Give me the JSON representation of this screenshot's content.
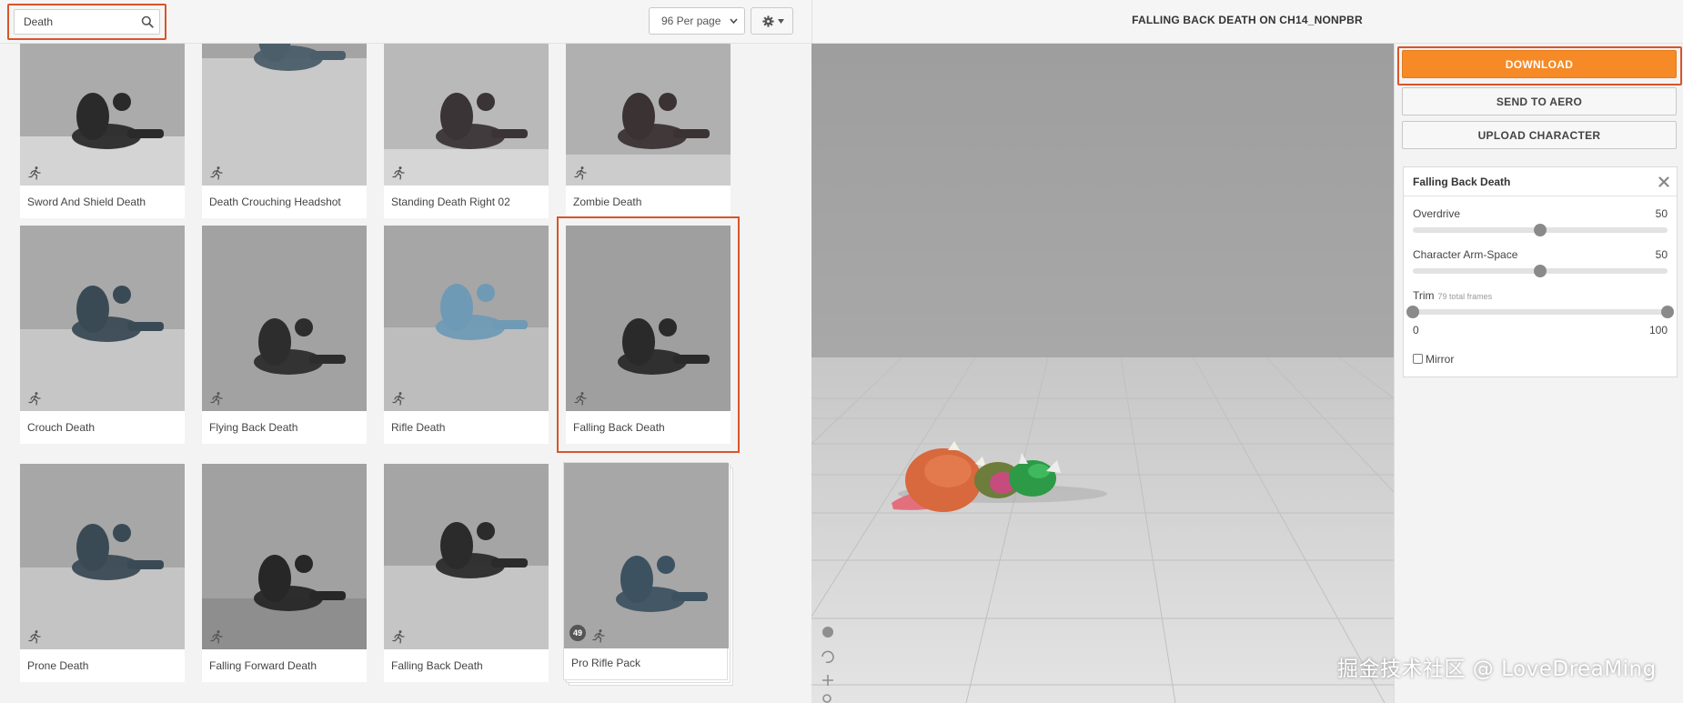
{
  "search": {
    "value": "Death",
    "placeholder": "Search"
  },
  "toolbar": {
    "per_page": "96 Per page"
  },
  "viewer": {
    "title": "FALLING BACK DEATH ON CH14_NONPBR"
  },
  "actions": {
    "download": "DOWNLOAD",
    "send_to_aero": "SEND TO AERO",
    "upload_character": "UPLOAD CHARACTER"
  },
  "settings": {
    "title": "Falling Back Death",
    "overdrive": {
      "label": "Overdrive",
      "value": "50",
      "level": 0.5
    },
    "arm_space": {
      "label": "Character Arm-Space",
      "value": "50",
      "level": 0.5
    },
    "trim": {
      "label": "Trim",
      "frames": "79 total frames",
      "min": "0",
      "max": "100",
      "start": 0,
      "end": 1
    },
    "mirror": {
      "label": "Mirror",
      "checked": false
    }
  },
  "grid": {
    "rows": [
      [
        {
          "label": "Sword And Shield Death"
        },
        {
          "label": "Death Crouching Headshot"
        },
        {
          "label": "Standing Death Right 02"
        },
        {
          "label": "Zombie Death"
        }
      ],
      [
        {
          "label": "Crouch Death"
        },
        {
          "label": "Flying Back Death"
        },
        {
          "label": "Rifle Death"
        },
        {
          "label": "Falling Back Death",
          "selected": true
        }
      ],
      [
        {
          "label": "Prone Death"
        },
        {
          "label": "Falling Forward Death"
        },
        {
          "label": "Falling Back Death"
        },
        {
          "label": "Pro Rifle Pack",
          "pack_count": "49"
        }
      ]
    ]
  },
  "colors": {
    "accent": "#d9542b",
    "download": "#f58a26"
  },
  "icons": [
    "search-icon",
    "caret-down-icon",
    "gear-icon",
    "animation-runner-icon",
    "close-icon"
  ],
  "watermark": "掘金技术社区 @ LoveDreaMing"
}
